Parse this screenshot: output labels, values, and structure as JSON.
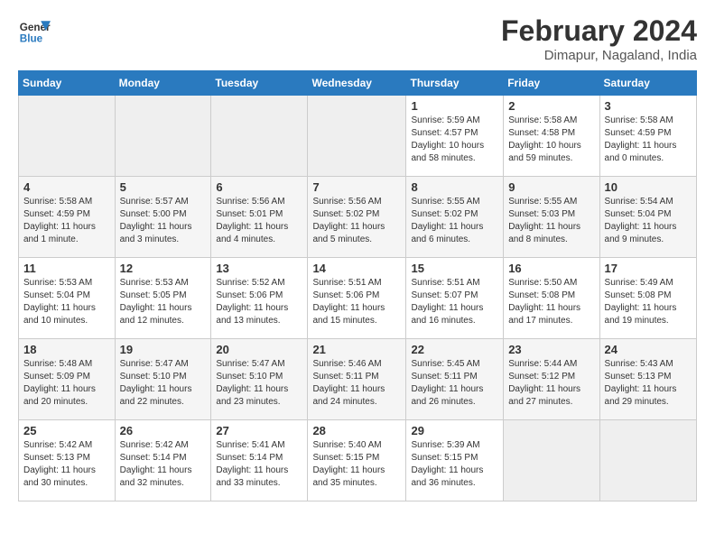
{
  "header": {
    "logo_line1": "General",
    "logo_line2": "Blue",
    "title": "February 2024",
    "subtitle": "Dimapur, Nagaland, India"
  },
  "days_of_week": [
    "Sunday",
    "Monday",
    "Tuesday",
    "Wednesday",
    "Thursday",
    "Friday",
    "Saturday"
  ],
  "weeks": [
    [
      {
        "day": "",
        "info": ""
      },
      {
        "day": "",
        "info": ""
      },
      {
        "day": "",
        "info": ""
      },
      {
        "day": "",
        "info": ""
      },
      {
        "day": "1",
        "info": "Sunrise: 5:59 AM\nSunset: 4:57 PM\nDaylight: 10 hours\nand 58 minutes."
      },
      {
        "day": "2",
        "info": "Sunrise: 5:58 AM\nSunset: 4:58 PM\nDaylight: 10 hours\nand 59 minutes."
      },
      {
        "day": "3",
        "info": "Sunrise: 5:58 AM\nSunset: 4:59 PM\nDaylight: 11 hours\nand 0 minutes."
      }
    ],
    [
      {
        "day": "4",
        "info": "Sunrise: 5:58 AM\nSunset: 4:59 PM\nDaylight: 11 hours\nand 1 minute."
      },
      {
        "day": "5",
        "info": "Sunrise: 5:57 AM\nSunset: 5:00 PM\nDaylight: 11 hours\nand 3 minutes."
      },
      {
        "day": "6",
        "info": "Sunrise: 5:56 AM\nSunset: 5:01 PM\nDaylight: 11 hours\nand 4 minutes."
      },
      {
        "day": "7",
        "info": "Sunrise: 5:56 AM\nSunset: 5:02 PM\nDaylight: 11 hours\nand 5 minutes."
      },
      {
        "day": "8",
        "info": "Sunrise: 5:55 AM\nSunset: 5:02 PM\nDaylight: 11 hours\nand 6 minutes."
      },
      {
        "day": "9",
        "info": "Sunrise: 5:55 AM\nSunset: 5:03 PM\nDaylight: 11 hours\nand 8 minutes."
      },
      {
        "day": "10",
        "info": "Sunrise: 5:54 AM\nSunset: 5:04 PM\nDaylight: 11 hours\nand 9 minutes."
      }
    ],
    [
      {
        "day": "11",
        "info": "Sunrise: 5:53 AM\nSunset: 5:04 PM\nDaylight: 11 hours\nand 10 minutes."
      },
      {
        "day": "12",
        "info": "Sunrise: 5:53 AM\nSunset: 5:05 PM\nDaylight: 11 hours\nand 12 minutes."
      },
      {
        "day": "13",
        "info": "Sunrise: 5:52 AM\nSunset: 5:06 PM\nDaylight: 11 hours\nand 13 minutes."
      },
      {
        "day": "14",
        "info": "Sunrise: 5:51 AM\nSunset: 5:06 PM\nDaylight: 11 hours\nand 15 minutes."
      },
      {
        "day": "15",
        "info": "Sunrise: 5:51 AM\nSunset: 5:07 PM\nDaylight: 11 hours\nand 16 minutes."
      },
      {
        "day": "16",
        "info": "Sunrise: 5:50 AM\nSunset: 5:08 PM\nDaylight: 11 hours\nand 17 minutes."
      },
      {
        "day": "17",
        "info": "Sunrise: 5:49 AM\nSunset: 5:08 PM\nDaylight: 11 hours\nand 19 minutes."
      }
    ],
    [
      {
        "day": "18",
        "info": "Sunrise: 5:48 AM\nSunset: 5:09 PM\nDaylight: 11 hours\nand 20 minutes."
      },
      {
        "day": "19",
        "info": "Sunrise: 5:47 AM\nSunset: 5:10 PM\nDaylight: 11 hours\nand 22 minutes."
      },
      {
        "day": "20",
        "info": "Sunrise: 5:47 AM\nSunset: 5:10 PM\nDaylight: 11 hours\nand 23 minutes."
      },
      {
        "day": "21",
        "info": "Sunrise: 5:46 AM\nSunset: 5:11 PM\nDaylight: 11 hours\nand 24 minutes."
      },
      {
        "day": "22",
        "info": "Sunrise: 5:45 AM\nSunset: 5:11 PM\nDaylight: 11 hours\nand 26 minutes."
      },
      {
        "day": "23",
        "info": "Sunrise: 5:44 AM\nSunset: 5:12 PM\nDaylight: 11 hours\nand 27 minutes."
      },
      {
        "day": "24",
        "info": "Sunrise: 5:43 AM\nSunset: 5:13 PM\nDaylight: 11 hours\nand 29 minutes."
      }
    ],
    [
      {
        "day": "25",
        "info": "Sunrise: 5:42 AM\nSunset: 5:13 PM\nDaylight: 11 hours\nand 30 minutes."
      },
      {
        "day": "26",
        "info": "Sunrise: 5:42 AM\nSunset: 5:14 PM\nDaylight: 11 hours\nand 32 minutes."
      },
      {
        "day": "27",
        "info": "Sunrise: 5:41 AM\nSunset: 5:14 PM\nDaylight: 11 hours\nand 33 minutes."
      },
      {
        "day": "28",
        "info": "Sunrise: 5:40 AM\nSunset: 5:15 PM\nDaylight: 11 hours\nand 35 minutes."
      },
      {
        "day": "29",
        "info": "Sunrise: 5:39 AM\nSunset: 5:15 PM\nDaylight: 11 hours\nand 36 minutes."
      },
      {
        "day": "",
        "info": ""
      },
      {
        "day": "",
        "info": ""
      }
    ]
  ]
}
